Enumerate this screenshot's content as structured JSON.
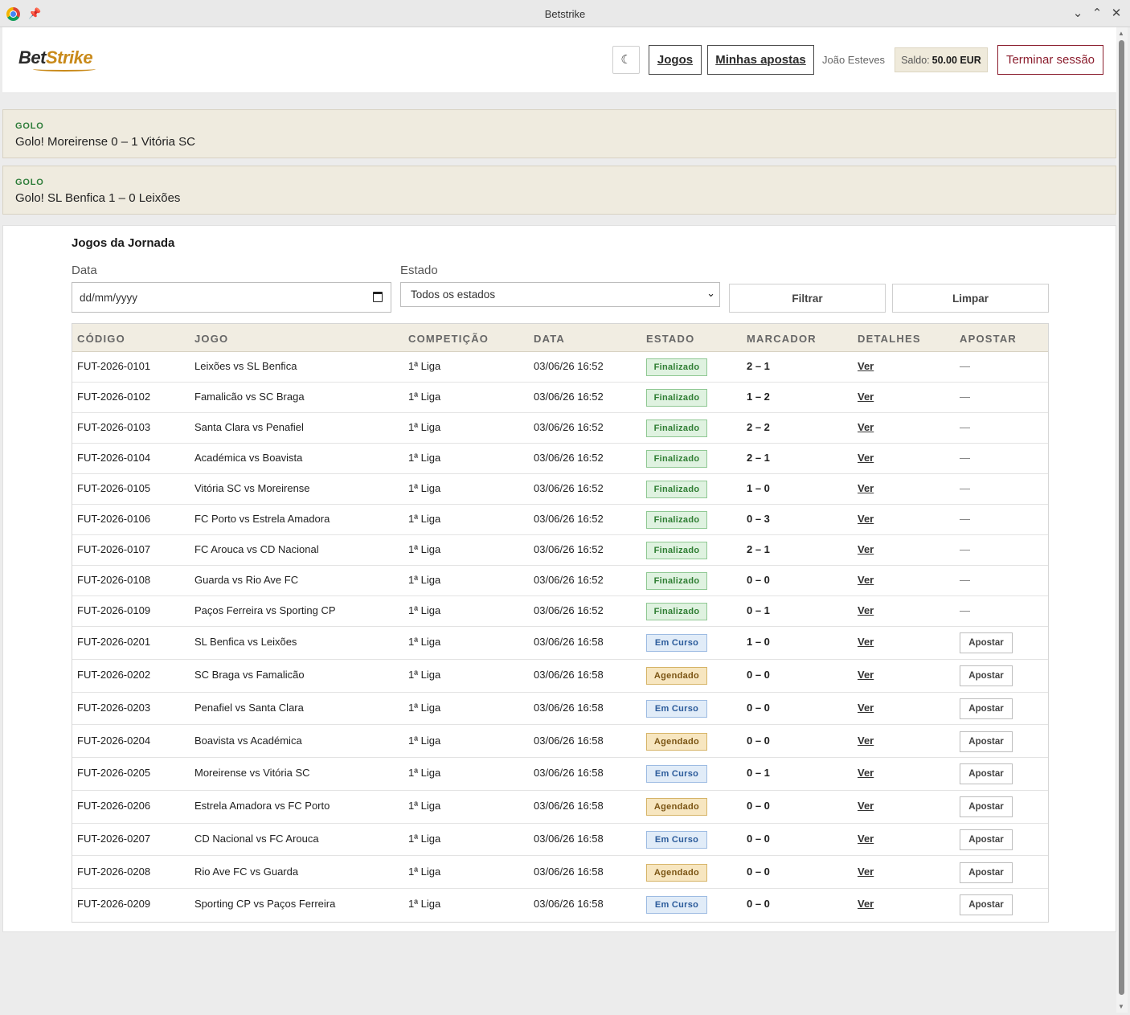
{
  "window": {
    "title": "Betstrike"
  },
  "header": {
    "logo_part1": "Bet",
    "logo_part2": "Strike",
    "nav_jogos": "Jogos",
    "nav_apostas": "Minhas apostas",
    "user_name": "João Esteves",
    "saldo_label": "Saldo:",
    "saldo_value": "50.00 EUR",
    "logout": "Terminar sessão"
  },
  "notifications": [
    {
      "tag": "GOLO",
      "message": "Golo! Moreirense 0 – 1 Vitória SC"
    },
    {
      "tag": "GOLO",
      "message": "Golo! SL Benfica 1 – 0 Leixões"
    }
  ],
  "main": {
    "title": "Jogos da Jornada",
    "filters": {
      "date_label": "Data",
      "date_placeholder": "dd/mm/yyyy",
      "status_label": "Estado",
      "status_selected": "Todos os estados",
      "filter_button": "Filtrar",
      "clear_button": "Limpar"
    },
    "table": {
      "headers": [
        "CÓDIGO",
        "JOGO",
        "COMPETIÇÃO",
        "DATA",
        "ESTADO",
        "MARCADOR",
        "DETALHES",
        "APOSTAR"
      ],
      "rows": [
        {
          "code": "FUT-2026-0101",
          "match": "Leixões vs SL Benfica",
          "competition": "1ª Liga",
          "date": "03/06/26 16:52",
          "status": "Finalizado",
          "score": "2 – 1",
          "details": "Ver",
          "bet": "—"
        },
        {
          "code": "FUT-2026-0102",
          "match": "Famalicão vs SC Braga",
          "competition": "1ª Liga",
          "date": "03/06/26 16:52",
          "status": "Finalizado",
          "score": "1 – 2",
          "details": "Ver",
          "bet": "—"
        },
        {
          "code": "FUT-2026-0103",
          "match": "Santa Clara vs Penafiel",
          "competition": "1ª Liga",
          "date": "03/06/26 16:52",
          "status": "Finalizado",
          "score": "2 – 2",
          "details": "Ver",
          "bet": "—"
        },
        {
          "code": "FUT-2026-0104",
          "match": "Académica vs Boavista",
          "competition": "1ª Liga",
          "date": "03/06/26 16:52",
          "status": "Finalizado",
          "score": "2 – 1",
          "details": "Ver",
          "bet": "—"
        },
        {
          "code": "FUT-2026-0105",
          "match": "Vitória SC vs Moreirense",
          "competition": "1ª Liga",
          "date": "03/06/26 16:52",
          "status": "Finalizado",
          "score": "1 – 0",
          "details": "Ver",
          "bet": "—"
        },
        {
          "code": "FUT-2026-0106",
          "match": "FC Porto vs Estrela Amadora",
          "competition": "1ª Liga",
          "date": "03/06/26 16:52",
          "status": "Finalizado",
          "score": "0 – 3",
          "details": "Ver",
          "bet": "—"
        },
        {
          "code": "FUT-2026-0107",
          "match": "FC Arouca vs CD Nacional",
          "competition": "1ª Liga",
          "date": "03/06/26 16:52",
          "status": "Finalizado",
          "score": "2 – 1",
          "details": "Ver",
          "bet": "—"
        },
        {
          "code": "FUT-2026-0108",
          "match": "Guarda vs Rio Ave FC",
          "competition": "1ª Liga",
          "date": "03/06/26 16:52",
          "status": "Finalizado",
          "score": "0 – 0",
          "details": "Ver",
          "bet": "—"
        },
        {
          "code": "FUT-2026-0109",
          "match": "Paços Ferreira vs Sporting CP",
          "competition": "1ª Liga",
          "date": "03/06/26 16:52",
          "status": "Finalizado",
          "score": "0 – 1",
          "details": "Ver",
          "bet": "—"
        },
        {
          "code": "FUT-2026-0201",
          "match": "SL Benfica vs Leixões",
          "competition": "1ª Liga",
          "date": "03/06/26 16:58",
          "status": "Em Curso",
          "score": "1 – 0",
          "details": "Ver",
          "bet": "Apostar"
        },
        {
          "code": "FUT-2026-0202",
          "match": "SC Braga vs Famalicão",
          "competition": "1ª Liga",
          "date": "03/06/26 16:58",
          "status": "Agendado",
          "score": "0 – 0",
          "details": "Ver",
          "bet": "Apostar"
        },
        {
          "code": "FUT-2026-0203",
          "match": "Penafiel vs Santa Clara",
          "competition": "1ª Liga",
          "date": "03/06/26 16:58",
          "status": "Em Curso",
          "score": "0 – 0",
          "details": "Ver",
          "bet": "Apostar"
        },
        {
          "code": "FUT-2026-0204",
          "match": "Boavista vs Académica",
          "competition": "1ª Liga",
          "date": "03/06/26 16:58",
          "status": "Agendado",
          "score": "0 – 0",
          "details": "Ver",
          "bet": "Apostar"
        },
        {
          "code": "FUT-2026-0205",
          "match": "Moreirense vs Vitória SC",
          "competition": "1ª Liga",
          "date": "03/06/26 16:58",
          "status": "Em Curso",
          "score": "0 – 1",
          "details": "Ver",
          "bet": "Apostar"
        },
        {
          "code": "FUT-2026-0206",
          "match": "Estrela Amadora vs FC Porto",
          "competition": "1ª Liga",
          "date": "03/06/26 16:58",
          "status": "Agendado",
          "score": "0 – 0",
          "details": "Ver",
          "bet": "Apostar"
        },
        {
          "code": "FUT-2026-0207",
          "match": "CD Nacional vs FC Arouca",
          "competition": "1ª Liga",
          "date": "03/06/26 16:58",
          "status": "Em Curso",
          "score": "0 – 0",
          "details": "Ver",
          "bet": "Apostar"
        },
        {
          "code": "FUT-2026-0208",
          "match": "Rio Ave FC vs Guarda",
          "competition": "1ª Liga",
          "date": "03/06/26 16:58",
          "status": "Agendado",
          "score": "0 – 0",
          "details": "Ver",
          "bet": "Apostar"
        },
        {
          "code": "FUT-2026-0209",
          "match": "Sporting CP vs Paços Ferreira",
          "competition": "1ª Liga",
          "date": "03/06/26 16:58",
          "status": "Em Curso",
          "score": "0 – 0",
          "details": "Ver",
          "bet": "Apostar"
        }
      ]
    }
  },
  "colors": {
    "accent_gold": "#c98a1a",
    "logout_red": "#8b1e2e",
    "notif_bg": "#efebdf",
    "golo_green": "#2e7d3a",
    "status_finalizado": "#dff2e0",
    "status_em_curso": "#e1ecf8",
    "status_agendado": "#f7e6c0"
  },
  "icons": {
    "app": "chrome-icon",
    "pin": "pin-icon",
    "theme": "moon-icon",
    "calendar": "calendar-icon",
    "select": "chevron-down-icon"
  }
}
